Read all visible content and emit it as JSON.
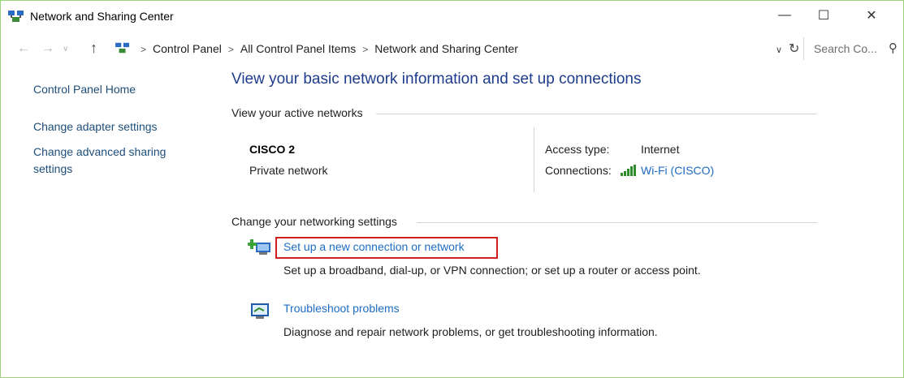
{
  "window": {
    "title": "Network and Sharing Center",
    "controls": {
      "minimize": "—",
      "maximize": "☐",
      "close": "✕"
    }
  },
  "address_bar": {
    "breadcrumbs": [
      "Control Panel",
      "All Control Panel Items",
      "Network and Sharing Center"
    ],
    "search_placeholder": "Search Co..."
  },
  "sidebar": {
    "items": [
      {
        "label": "Control Panel Home"
      },
      {
        "label": "Change adapter settings"
      },
      {
        "label": "Change advanced sharing settings"
      }
    ]
  },
  "main": {
    "heading": "View your basic network information and set up connections",
    "active_networks_label": "View your active networks",
    "network": {
      "name": "CISCO 2",
      "type": "Private network",
      "access_type_label": "Access type:",
      "access_type_value": "Internet",
      "connections_label": "Connections:",
      "connections_value": "Wi-Fi (CISCO)"
    },
    "change_settings_label": "Change your networking settings",
    "tasks": [
      {
        "label": "Set up a new connection or network",
        "description": "Set up a broadband, dial-up, or VPN connection; or set up a router or access point.",
        "icon": "new-connection-icon",
        "highlighted": true
      },
      {
        "label": "Troubleshoot problems",
        "description": "Diagnose and repair network problems, or get troubleshooting information.",
        "icon": "troubleshoot-icon",
        "highlighted": false
      }
    ]
  },
  "colors": {
    "link": "#1e6cc4",
    "sidebar_link": "#1e4e79",
    "heading": "#1e3c8c",
    "highlight": "#d02020"
  }
}
